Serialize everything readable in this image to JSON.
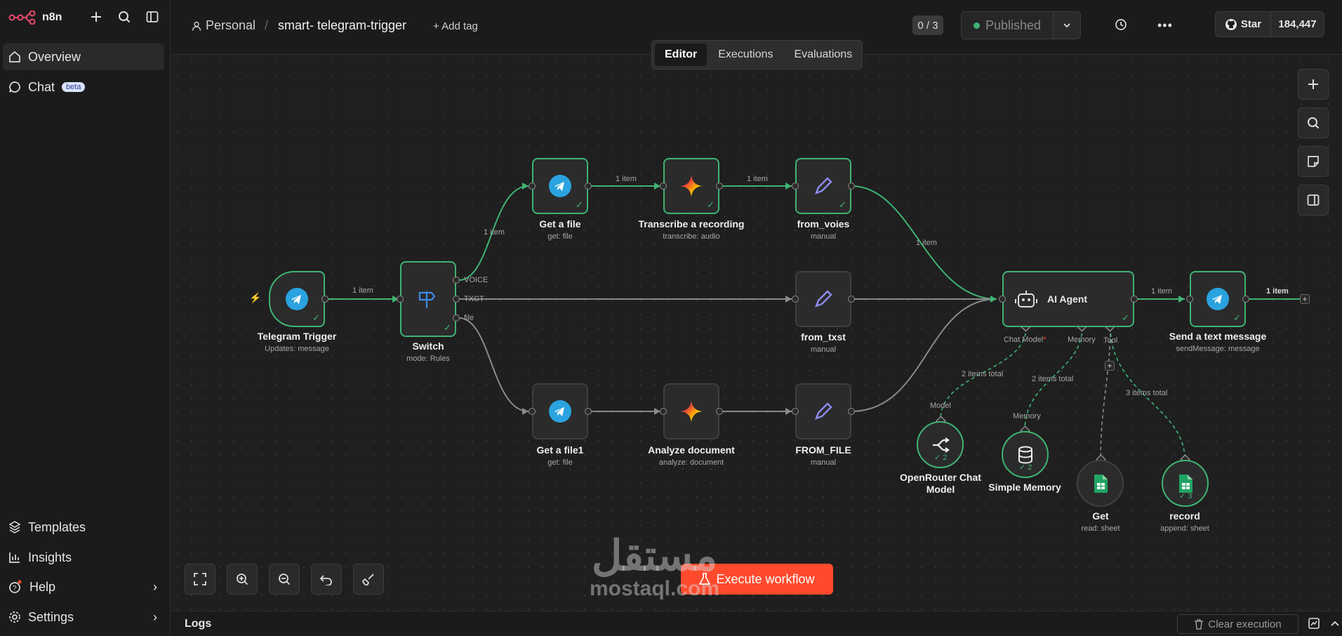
{
  "app": {
    "logo_text": "n8n"
  },
  "sidebar": {
    "items": [
      {
        "label": "Overview"
      },
      {
        "label": "Chat",
        "badge": "beta"
      }
    ],
    "bottom_items": [
      {
        "label": "Templates"
      },
      {
        "label": "Insights"
      },
      {
        "label": "Help"
      },
      {
        "label": "Settings"
      }
    ]
  },
  "header": {
    "project": "Personal",
    "separator": "/",
    "workflow_name": "smart- telegram-trigger",
    "add_tag": "+ Add tag",
    "counter": "0 / 3",
    "publish_label": "Published",
    "github_star": "Star",
    "github_count": "184,447"
  },
  "tabs": [
    {
      "label": "Editor"
    },
    {
      "label": "Executions"
    },
    {
      "label": "Evaluations"
    }
  ],
  "nodes": [
    {
      "name": "Telegram Trigger",
      "sub": "Updates: message"
    },
    {
      "name": "Switch",
      "sub": "mode: Rules"
    },
    {
      "name": "Get a file",
      "sub": "get: file"
    },
    {
      "name": "Transcribe a recording",
      "sub": "transcribe: audio"
    },
    {
      "name": "from_voies",
      "sub": "manual"
    },
    {
      "name": "from_txst",
      "sub": "manual"
    },
    {
      "name": "Get a file1",
      "sub": "get: file"
    },
    {
      "name": "Analyze document",
      "sub": "analyze: document"
    },
    {
      "name": "FROM_FILE",
      "sub": "manual"
    },
    {
      "name": "AI Agent",
      "sub": ""
    },
    {
      "name": "Send a text message",
      "sub": "sendMessage: message"
    },
    {
      "name": "OpenRouter Chat Model",
      "sub": ""
    },
    {
      "name": "Simple Memory",
      "sub": ""
    },
    {
      "name": "Get",
      "sub": "read: sheet"
    },
    {
      "name": "record",
      "sub": "append: sheet"
    }
  ],
  "switch_outputs": [
    "VOICE",
    "TXCT",
    "file"
  ],
  "agent_ports": [
    "Chat Model",
    "Memory",
    "Tool"
  ],
  "edge_labels": {
    "trigger_switch": "1 item",
    "switch_getfile": "1 item",
    "getfile_transcribe": "1 item",
    "transcribe_voies": "1 item",
    "voies_agent": "1 item",
    "agent_send": "1 item",
    "send_out": "1 item",
    "model_total": "2 items total",
    "memory_total": "2 items total",
    "tools_total": "3 items total",
    "model_port": "Model",
    "memory_port": "Memory"
  },
  "sub_counts": {
    "model": "2",
    "memory": "2",
    "record": "3"
  },
  "execute_label": "Execute workflow",
  "logs": {
    "label": "Logs",
    "clear": "Clear execution"
  },
  "watermark": {
    "arabic": "مستقل",
    "latin": "mostaql.com"
  },
  "colors": {
    "accent_green": "#3fb472",
    "execute": "#ff4a2d",
    "telegram": "#2aa3e0",
    "sheets": "#21a464"
  }
}
